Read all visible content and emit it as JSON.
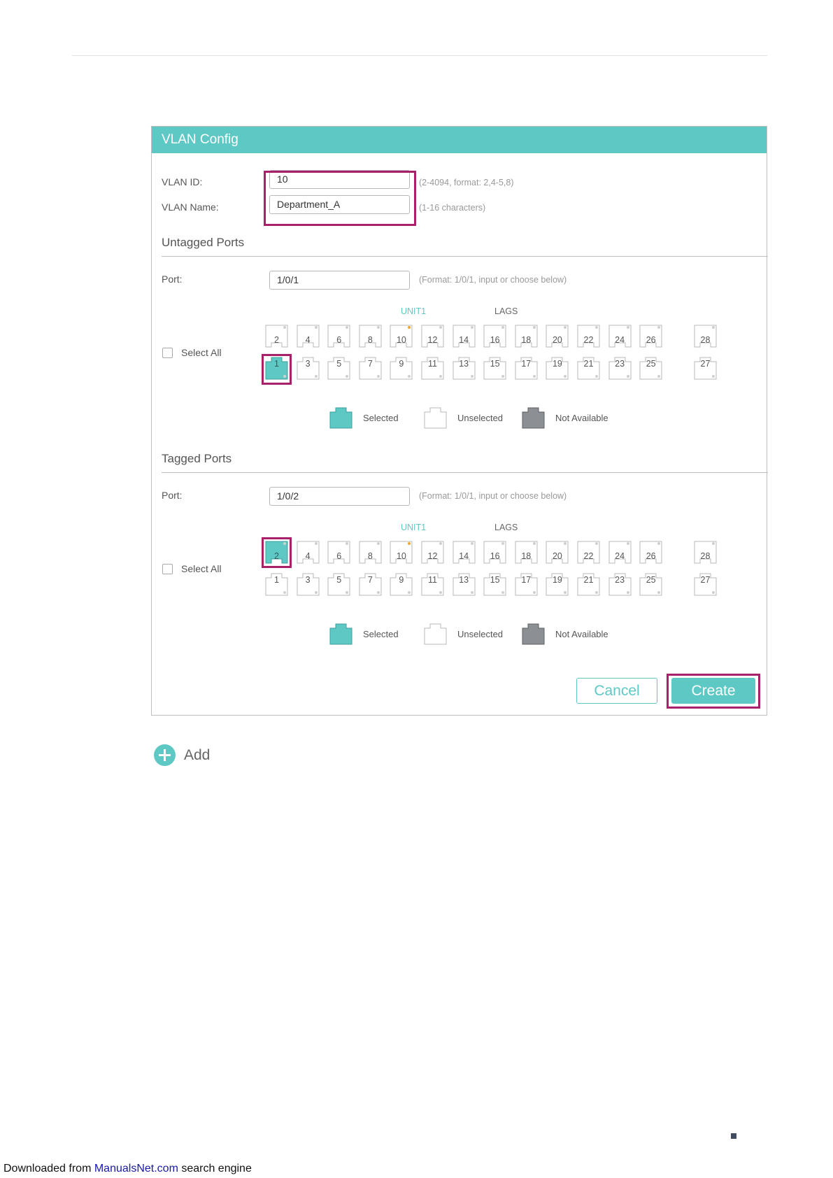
{
  "panel": {
    "title": "VLAN Config",
    "vlan_id": {
      "label": "VLAN ID:",
      "value": "10",
      "hint": "(2-4094, format: 2,4-5,8)"
    },
    "vlan_name": {
      "label": "VLAN Name:",
      "value": "Department_A",
      "hint": "(1-16 characters)"
    },
    "untagged": {
      "title": "Untagged Ports",
      "port_label": "Port:",
      "port_value": "1/0/1",
      "port_hint": "(Format: 1/0/1, input or choose below)",
      "unit_label": "UNIT1",
      "lags_label": "LAGS",
      "select_all": "Select All",
      "selected_ports": [
        "1"
      ]
    },
    "tagged": {
      "title": "Tagged Ports",
      "port_label": "Port:",
      "port_value": "1/0/2",
      "port_hint": "(Format: 1/0/1, input or choose below)",
      "unit_label": "UNIT1",
      "lags_label": "LAGS",
      "select_all": "Select All",
      "selected_ports": [
        "2"
      ]
    },
    "ports_top": [
      "2",
      "4",
      "6",
      "8",
      "10",
      "12",
      "14",
      "16",
      "18",
      "20",
      "22",
      "24",
      "26",
      "28"
    ],
    "ports_bottom": [
      "1",
      "3",
      "5",
      "7",
      "9",
      "11",
      "13",
      "15",
      "17",
      "19",
      "21",
      "23",
      "25",
      "27"
    ],
    "legend": {
      "selected": "Selected",
      "unselected": "Unselected",
      "not_available": "Not Available"
    },
    "buttons": {
      "cancel": "Cancel",
      "create": "Create"
    }
  },
  "add_label": "Add",
  "footer": {
    "prefix": "Downloaded from ",
    "link": "ManualsNet.com",
    "suffix": " search engine"
  },
  "colors": {
    "accent": "#5ec8c5",
    "highlight": "#a8206a",
    "not_available": "#8c8f93",
    "link_port_dot": "#f0a830"
  }
}
